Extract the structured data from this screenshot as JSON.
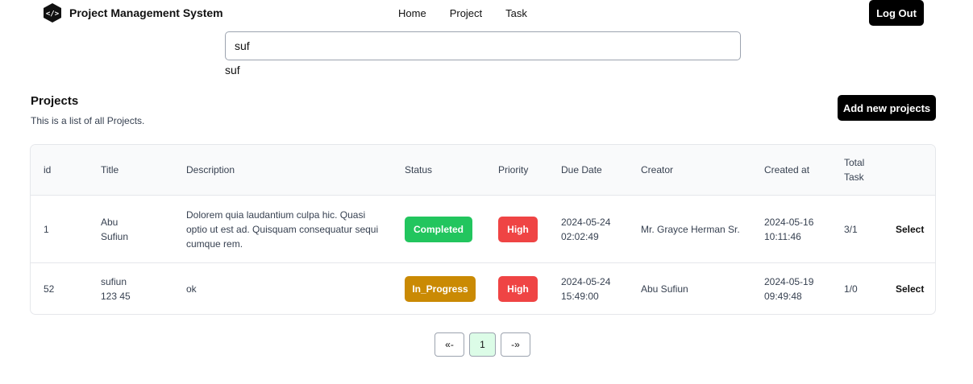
{
  "navbar": {
    "brand": "Project Management System",
    "links": [
      "Home",
      "Project",
      "Task"
    ],
    "logout_label": "Log Out"
  },
  "search": {
    "value": "suf",
    "echo": "suf"
  },
  "section": {
    "title": "Projects",
    "subtitle": "This is a list of all Projects.",
    "add_label": "Add new projects"
  },
  "table": {
    "headers": [
      "id",
      "Title",
      "Description",
      "Status",
      "Priority",
      "Due Date",
      "Creator",
      "Created at",
      "Total\nTask"
    ],
    "rows": [
      {
        "id": "1",
        "title": "Abu\nSufiun",
        "description": "Dolorem quia laudantium culpa hic. Quasi optio ut est ad. Quisquam consequatur sequi cumque rem.",
        "status": "Completed",
        "priority": "High",
        "due_date": "2024-05-24\n02:02:49",
        "creator": "Mr. Grayce Herman Sr.",
        "created_at": "2024-05-16\n10:11:46",
        "total_task": "3/1",
        "action": "Select"
      },
      {
        "id": "52",
        "title": "sufiun\n123 45",
        "description": "ok",
        "status": "In_Progress",
        "priority": "High",
        "due_date": "2024-05-24\n15:49:00",
        "creator": "Abu Sufiun",
        "created_at": "2024-05-19\n09:49:48",
        "total_task": "1/0",
        "action": "Select"
      }
    ]
  },
  "pagination": {
    "prev": "«-",
    "current": "1",
    "next": "-»"
  },
  "colors": {
    "completed": "#22c55e",
    "in_progress": "#ca8a04",
    "high": "#ef4444",
    "current_page": "#dcfce7"
  }
}
